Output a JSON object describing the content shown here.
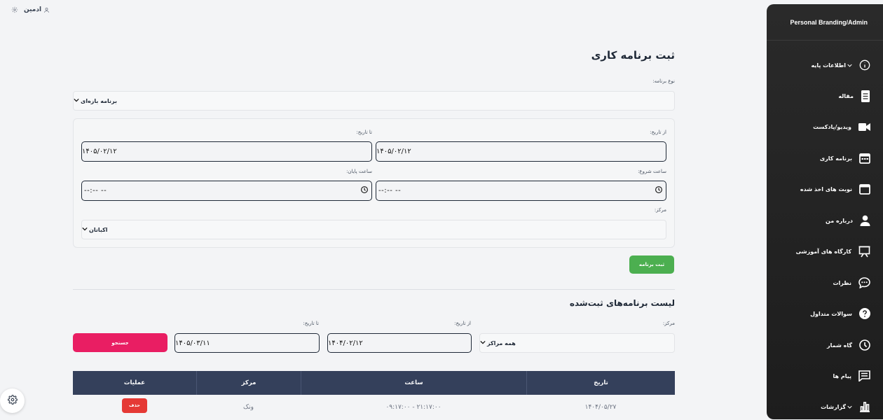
{
  "topbar": {
    "user_name": "ادمین"
  },
  "sidebar": {
    "title": "Personal Branding/Admin",
    "items": [
      {
        "label": "اطلاعات پایه",
        "icon": "info-icon",
        "has_chevron": true
      },
      {
        "label": "مقاله",
        "icon": "document-icon"
      },
      {
        "label": "ویدیو/پادکست",
        "icon": "video-icon"
      },
      {
        "label": "برنامه کاری",
        "icon": "calendar-grid-icon"
      },
      {
        "label": "نوبت های اخذ شده",
        "icon": "calendar-icon"
      },
      {
        "label": "درباره من",
        "icon": "person-icon"
      },
      {
        "label": "کارگاه های آموزشی",
        "icon": "presentation-icon"
      },
      {
        "label": "نظرات",
        "icon": "chat-dots-icon"
      },
      {
        "label": "سوالات متداول",
        "icon": "question-icon"
      },
      {
        "label": "گاه شمار",
        "icon": "clock-icon"
      },
      {
        "label": "پیام ها",
        "icon": "message-icon"
      },
      {
        "label": "گزارشات",
        "icon": "bar-chart-icon",
        "has_chevron": true
      }
    ]
  },
  "form": {
    "title": "ثبت برنامه کاری",
    "type_label": "نوع برنامه:",
    "type_value": "برنامه بازه‌ای",
    "from_date_label": "از تاریخ:",
    "from_date_value": "۱۴۰۵/۰۲/۱۲",
    "to_date_label": "تا تاریخ:",
    "to_date_value": "۱۴۰۵/۰۲/۱۲",
    "start_time_label": "ساعت شروع:",
    "end_time_label": "ساعت پایان:",
    "time_placeholder": "--:-- --",
    "center_label": "مرکز:",
    "center_value": "اکباتان",
    "submit_label": "ثبت برنامه"
  },
  "list": {
    "title": "لیست برنامه‌های ثبت‌شده",
    "center_label": "مرکز:",
    "center_value": "همه مراکز",
    "from_date_label": "از تاریخ:",
    "from_date_value": "۱۴۰۴/۰۲/۱۲",
    "to_date_label": "تا تاریخ:",
    "to_date_value": "۱۴۰۵/۰۳/۱۱",
    "search_label": "جستجو",
    "columns": [
      "تاریخ",
      "ساعت",
      "مرکز",
      "عملیات"
    ],
    "rows": [
      {
        "date": "۱۴۰۴/۰۵/۲۷",
        "time": "۰۹:۱۷:۰۰ - ۲۱:۱۷:۰۰",
        "center": "ونک",
        "delete_label": "حذف"
      }
    ]
  }
}
